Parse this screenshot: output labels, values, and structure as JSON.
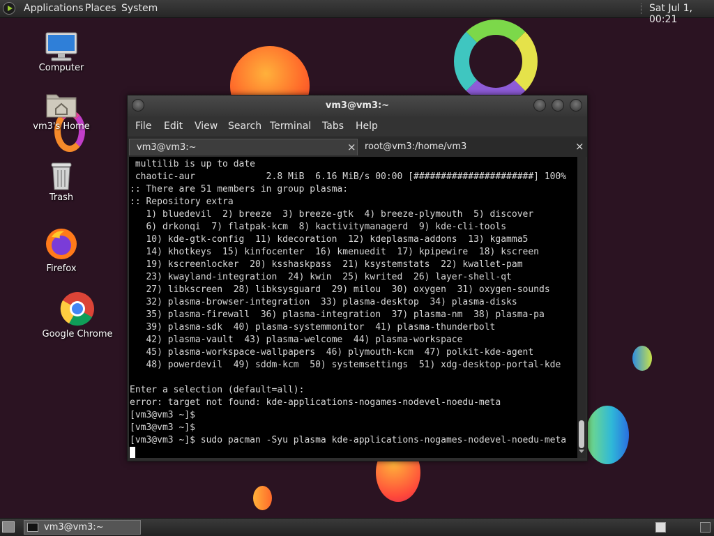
{
  "top_panel": {
    "applications": "Applications",
    "places": "Places",
    "system": "System",
    "clock": "Sat Jul  1, 00:21"
  },
  "desktop_icons": {
    "computer": "Computer",
    "home": "vm3's Home",
    "trash": "Trash",
    "firefox": "Firefox",
    "chrome": "Google Chrome"
  },
  "window": {
    "title": "vm3@vm3:~",
    "menu": [
      "File",
      "Edit",
      "View",
      "Search",
      "Terminal",
      "Tabs",
      "Help"
    ],
    "tabs": [
      {
        "label": "vm3@vm3:~",
        "close": "×"
      },
      {
        "label": "root@vm3:/home/vm3",
        "close": "×"
      }
    ]
  },
  "terminal": {
    "lines": [
      " multilib is up to date",
      " chaotic-aur             2.8 MiB  6.16 MiB/s 00:00 [######################] 100%",
      ":: There are 51 members in group plasma:",
      ":: Repository extra",
      "   1) bluedevil  2) breeze  3) breeze-gtk  4) breeze-plymouth  5) discover",
      "   6) drkonqi  7) flatpak-kcm  8) kactivitymanagerd  9) kde-cli-tools",
      "   10) kde-gtk-config  11) kdecoration  12) kdeplasma-addons  13) kgamma5",
      "   14) khotkeys  15) kinfocenter  16) kmenuedit  17) kpipewire  18) kscreen",
      "   19) kscreenlocker  20) ksshaskpass  21) ksystemstats  22) kwallet-pam",
      "   23) kwayland-integration  24) kwin  25) kwrited  26) layer-shell-qt",
      "   27) libkscreen  28) libksysguard  29) milou  30) oxygen  31) oxygen-sounds",
      "   32) plasma-browser-integration  33) plasma-desktop  34) plasma-disks",
      "   35) plasma-firewall  36) plasma-integration  37) plasma-nm  38) plasma-pa",
      "   39) plasma-sdk  40) plasma-systemmonitor  41) plasma-thunderbolt",
      "   42) plasma-vault  43) plasma-welcome  44) plasma-workspace",
      "   45) plasma-workspace-wallpapers  46) plymouth-kcm  47) polkit-kde-agent",
      "   48) powerdevil  49) sddm-kcm  50) systemsettings  51) xdg-desktop-portal-kde",
      "",
      "Enter a selection (default=all):",
      "error: target not found: kde-applications-nogames-nodevel-noedu-meta",
      "[vm3@vm3 ~]$",
      "[vm3@vm3 ~]$",
      "[vm3@vm3 ~]$ sudo pacman -Syu plasma kde-applications-nogames-nodevel-noedu-meta",
      ""
    ]
  },
  "taskbar": {
    "task_label": "vm3@vm3:~"
  }
}
